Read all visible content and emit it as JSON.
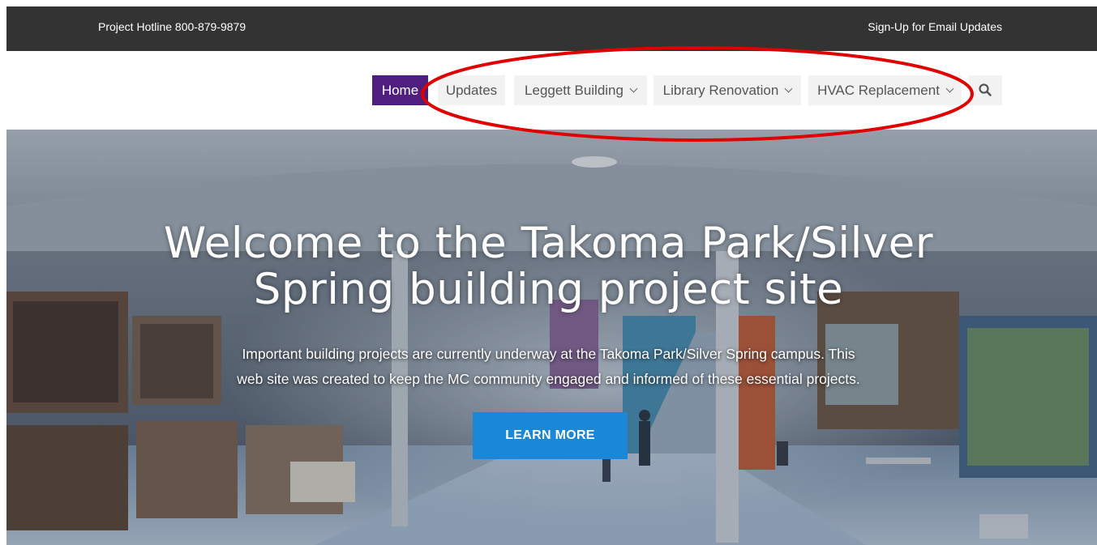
{
  "topbar": {
    "hotline": "Project Hotline 800-879-9879",
    "signup": "Sign-Up for Email Updates"
  },
  "nav": {
    "items": [
      {
        "label": "Home",
        "active": true,
        "has_dropdown": false
      },
      {
        "label": "Updates",
        "active": false,
        "has_dropdown": false
      },
      {
        "label": "Leggett Building",
        "active": false,
        "has_dropdown": true
      },
      {
        "label": "Library Renovation",
        "active": false,
        "has_dropdown": true
      },
      {
        "label": "HVAC Replacement",
        "active": false,
        "has_dropdown": true
      }
    ],
    "search_icon": "search-icon"
  },
  "hero": {
    "title_line1": "Welcome to the Takoma Park/Silver",
    "title_line2": "Spring building project site",
    "text_line1": "Important building projects are currently underway at the Takoma Park/Silver Spring campus. This",
    "text_line2": "web site was created to keep the MC community engaged and informed of these essential projects.",
    "button_label": "LEARN MORE"
  },
  "colors": {
    "topbar_bg": "#333333",
    "nav_active_bg": "#4e1f7f",
    "nav_item_bg": "#f2f2f2",
    "button_bg": "#1a88d6",
    "annotation": "#e00000"
  }
}
